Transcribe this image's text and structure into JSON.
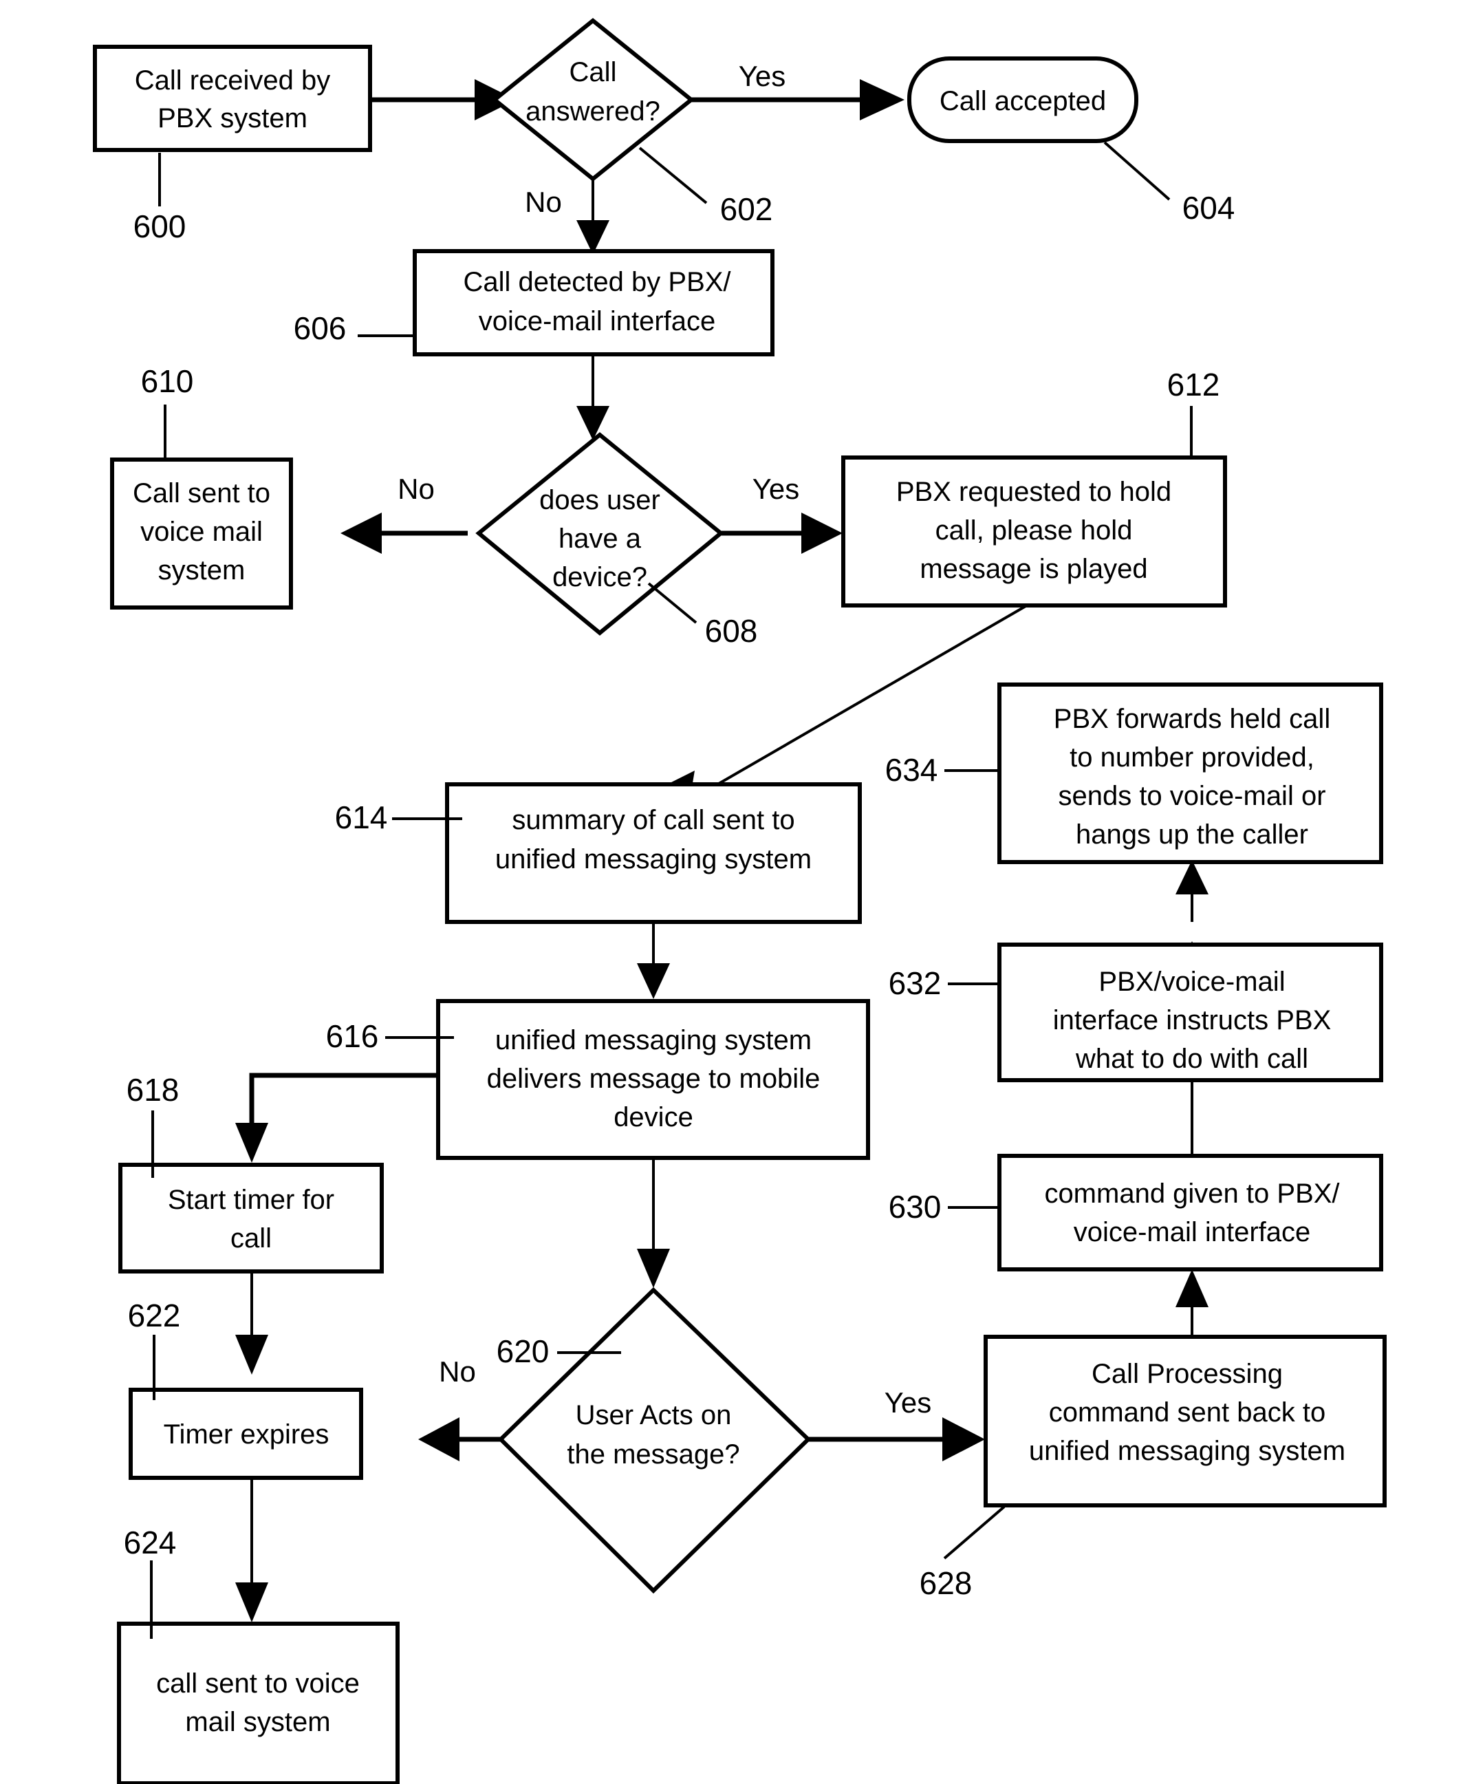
{
  "diagram": {
    "title": "PBX call handling flowchart",
    "stroke_color": "#000000",
    "fill_color": "#ffffff",
    "nodes": [
      {
        "ref": "600",
        "shape": "rectangle",
        "text_lines": [
          "Call received by",
          "PBX system"
        ]
      },
      {
        "ref": "602",
        "shape": "diamond",
        "text_lines": [
          "Call",
          "answered?"
        ]
      },
      {
        "ref": "604",
        "shape": "rounded-rectangle",
        "text_lines": [
          "Call accepted"
        ]
      },
      {
        "ref": "606",
        "shape": "rectangle",
        "text_lines": [
          "Call detected by PBX/",
          "voice-mail interface"
        ]
      },
      {
        "ref": "608",
        "shape": "diamond",
        "text_lines": [
          "does user",
          "have a",
          "device?"
        ]
      },
      {
        "ref": "610",
        "shape": "rectangle",
        "text_lines": [
          "Call sent to",
          "voice mail",
          "system"
        ]
      },
      {
        "ref": "612",
        "shape": "rectangle",
        "text_lines": [
          "PBX requested to hold",
          "call, please hold",
          "message is played"
        ]
      },
      {
        "ref": "614",
        "shape": "rectangle",
        "text_lines": [
          "summary of call sent to",
          "unified messaging system"
        ]
      },
      {
        "ref": "616",
        "shape": "rectangle",
        "text_lines": [
          "unified messaging system",
          "delivers message to mobile",
          "device"
        ]
      },
      {
        "ref": "618",
        "shape": "rectangle",
        "text_lines": [
          "Start timer for",
          "call"
        ]
      },
      {
        "ref": "620",
        "shape": "diamond",
        "text_lines": [
          "User Acts on",
          "the message?"
        ]
      },
      {
        "ref": "622",
        "shape": "rectangle",
        "text_lines": [
          "Timer expires"
        ]
      },
      {
        "ref": "624",
        "shape": "rectangle",
        "text_lines": [
          "call sent to voice",
          "mail system"
        ]
      },
      {
        "ref": "628",
        "shape": "rectangle",
        "text_lines": [
          "Call Processing",
          "command sent back to",
          "unified messaging system"
        ]
      },
      {
        "ref": "630",
        "shape": "rectangle",
        "text_lines": [
          "command given to PBX/",
          "voice-mail interface"
        ]
      },
      {
        "ref": "632",
        "shape": "rectangle",
        "text_lines": [
          "PBX/voice-mail",
          "interface instructs PBX",
          "what to do with call"
        ]
      },
      {
        "ref": "634",
        "shape": "rectangle",
        "text_lines": [
          "PBX forwards held call",
          "to number provided,",
          "sends to voice-mail or",
          "hangs up the caller"
        ]
      }
    ],
    "edge_labels": {
      "answered_yes": "Yes",
      "answered_no": "No",
      "device_yes": "Yes",
      "device_no": "No",
      "acts_yes": "Yes",
      "acts_no": "No"
    },
    "node_text": {
      "n600_l1": "Call received by",
      "n600_l2": "PBX system",
      "n602_l1": "Call",
      "n602_l2": "answered?",
      "n604_l1": "Call accepted",
      "n606_l1": "Call detected by PBX/",
      "n606_l2": "voice-mail interface",
      "n608_l1": "does user",
      "n608_l2": "have a",
      "n608_l3": "device?",
      "n610_l1": "Call sent to",
      "n610_l2": "voice mail",
      "n610_l3": "system",
      "n612_l1": "PBX requested to hold",
      "n612_l2": "call, please hold",
      "n612_l3": "message is played",
      "n614_l1": "summary of call sent to",
      "n614_l2": "unified messaging system",
      "n616_l1": "unified messaging system",
      "n616_l2": "delivers message to mobile",
      "n616_l3": "device",
      "n618_l1": "Start timer for",
      "n618_l2": "call",
      "n620_l1": "User Acts on",
      "n620_l2": "the message?",
      "n622_l1": "Timer expires",
      "n624_l1": "call sent to voice",
      "n624_l2": "mail system",
      "n628_l1": "Call Processing",
      "n628_l2": "command sent back to",
      "n628_l3": "unified messaging system",
      "n630_l1": "command given to PBX/",
      "n630_l2": "voice-mail interface",
      "n632_l1": "PBX/voice-mail",
      "n632_l2": "interface instructs PBX",
      "n632_l3": "what to do with call",
      "n634_l1": "PBX forwards held call",
      "n634_l2": "to number provided,",
      "n634_l3": "sends to voice-mail or",
      "n634_l4": "hangs up the caller"
    },
    "ref_labels": {
      "r600": "600",
      "r602": "602",
      "r604": "604",
      "r606": "606",
      "r608": "608",
      "r610": "610",
      "r612": "612",
      "r614": "614",
      "r616": "616",
      "r618": "618",
      "r620": "620",
      "r622": "622",
      "r624": "624",
      "r628": "628",
      "r630": "630",
      "r632": "632",
      "r634": "634"
    }
  }
}
